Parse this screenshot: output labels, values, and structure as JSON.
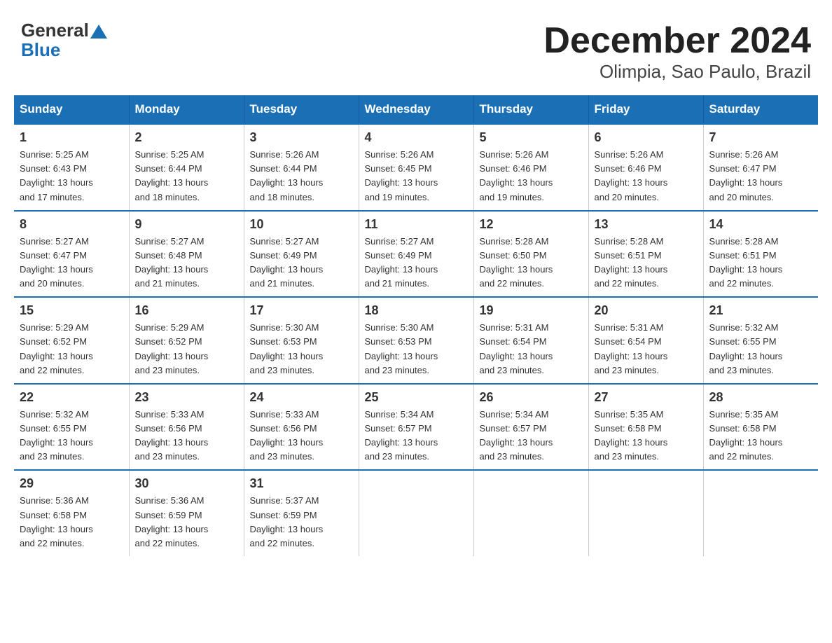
{
  "header": {
    "logo_general": "General",
    "logo_blue": "Blue",
    "title": "December 2024",
    "subtitle": "Olimpia, Sao Paulo, Brazil"
  },
  "days_of_week": [
    "Sunday",
    "Monday",
    "Tuesday",
    "Wednesday",
    "Thursday",
    "Friday",
    "Saturday"
  ],
  "weeks": [
    [
      {
        "day": "1",
        "sunrise": "5:25 AM",
        "sunset": "6:43 PM",
        "daylight": "13 hours and 17 minutes."
      },
      {
        "day": "2",
        "sunrise": "5:25 AM",
        "sunset": "6:44 PM",
        "daylight": "13 hours and 18 minutes."
      },
      {
        "day": "3",
        "sunrise": "5:26 AM",
        "sunset": "6:44 PM",
        "daylight": "13 hours and 18 minutes."
      },
      {
        "day": "4",
        "sunrise": "5:26 AM",
        "sunset": "6:45 PM",
        "daylight": "13 hours and 19 minutes."
      },
      {
        "day": "5",
        "sunrise": "5:26 AM",
        "sunset": "6:46 PM",
        "daylight": "13 hours and 19 minutes."
      },
      {
        "day": "6",
        "sunrise": "5:26 AM",
        "sunset": "6:46 PM",
        "daylight": "13 hours and 20 minutes."
      },
      {
        "day": "7",
        "sunrise": "5:26 AM",
        "sunset": "6:47 PM",
        "daylight": "13 hours and 20 minutes."
      }
    ],
    [
      {
        "day": "8",
        "sunrise": "5:27 AM",
        "sunset": "6:47 PM",
        "daylight": "13 hours and 20 minutes."
      },
      {
        "day": "9",
        "sunrise": "5:27 AM",
        "sunset": "6:48 PM",
        "daylight": "13 hours and 21 minutes."
      },
      {
        "day": "10",
        "sunrise": "5:27 AM",
        "sunset": "6:49 PM",
        "daylight": "13 hours and 21 minutes."
      },
      {
        "day": "11",
        "sunrise": "5:27 AM",
        "sunset": "6:49 PM",
        "daylight": "13 hours and 21 minutes."
      },
      {
        "day": "12",
        "sunrise": "5:28 AM",
        "sunset": "6:50 PM",
        "daylight": "13 hours and 22 minutes."
      },
      {
        "day": "13",
        "sunrise": "5:28 AM",
        "sunset": "6:51 PM",
        "daylight": "13 hours and 22 minutes."
      },
      {
        "day": "14",
        "sunrise": "5:28 AM",
        "sunset": "6:51 PM",
        "daylight": "13 hours and 22 minutes."
      }
    ],
    [
      {
        "day": "15",
        "sunrise": "5:29 AM",
        "sunset": "6:52 PM",
        "daylight": "13 hours and 22 minutes."
      },
      {
        "day": "16",
        "sunrise": "5:29 AM",
        "sunset": "6:52 PM",
        "daylight": "13 hours and 23 minutes."
      },
      {
        "day": "17",
        "sunrise": "5:30 AM",
        "sunset": "6:53 PM",
        "daylight": "13 hours and 23 minutes."
      },
      {
        "day": "18",
        "sunrise": "5:30 AM",
        "sunset": "6:53 PM",
        "daylight": "13 hours and 23 minutes."
      },
      {
        "day": "19",
        "sunrise": "5:31 AM",
        "sunset": "6:54 PM",
        "daylight": "13 hours and 23 minutes."
      },
      {
        "day": "20",
        "sunrise": "5:31 AM",
        "sunset": "6:54 PM",
        "daylight": "13 hours and 23 minutes."
      },
      {
        "day": "21",
        "sunrise": "5:32 AM",
        "sunset": "6:55 PM",
        "daylight": "13 hours and 23 minutes."
      }
    ],
    [
      {
        "day": "22",
        "sunrise": "5:32 AM",
        "sunset": "6:55 PM",
        "daylight": "13 hours and 23 minutes."
      },
      {
        "day": "23",
        "sunrise": "5:33 AM",
        "sunset": "6:56 PM",
        "daylight": "13 hours and 23 minutes."
      },
      {
        "day": "24",
        "sunrise": "5:33 AM",
        "sunset": "6:56 PM",
        "daylight": "13 hours and 23 minutes."
      },
      {
        "day": "25",
        "sunrise": "5:34 AM",
        "sunset": "6:57 PM",
        "daylight": "13 hours and 23 minutes."
      },
      {
        "day": "26",
        "sunrise": "5:34 AM",
        "sunset": "6:57 PM",
        "daylight": "13 hours and 23 minutes."
      },
      {
        "day": "27",
        "sunrise": "5:35 AM",
        "sunset": "6:58 PM",
        "daylight": "13 hours and 23 minutes."
      },
      {
        "day": "28",
        "sunrise": "5:35 AM",
        "sunset": "6:58 PM",
        "daylight": "13 hours and 22 minutes."
      }
    ],
    [
      {
        "day": "29",
        "sunrise": "5:36 AM",
        "sunset": "6:58 PM",
        "daylight": "13 hours and 22 minutes."
      },
      {
        "day": "30",
        "sunrise": "5:36 AM",
        "sunset": "6:59 PM",
        "daylight": "13 hours and 22 minutes."
      },
      {
        "day": "31",
        "sunrise": "5:37 AM",
        "sunset": "6:59 PM",
        "daylight": "13 hours and 22 minutes."
      },
      null,
      null,
      null,
      null
    ]
  ],
  "labels": {
    "sunrise": "Sunrise:",
    "sunset": "Sunset:",
    "daylight": "Daylight:"
  }
}
